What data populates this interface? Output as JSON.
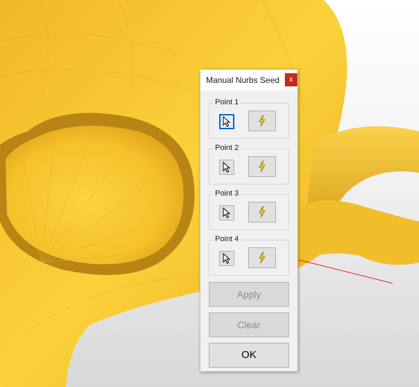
{
  "dialog": {
    "title": "Manual Nurbs Seed",
    "close_glyph": "x",
    "points": [
      {
        "label": "Point 1",
        "pick_icon": "cursor-icon",
        "seed_icon": "lightning-icon",
        "focused": true
      },
      {
        "label": "Point 2",
        "pick_icon": "cursor-icon",
        "seed_icon": "lightning-icon",
        "focused": false
      },
      {
        "label": "Point 3",
        "pick_icon": "cursor-icon",
        "seed_icon": "lightning-icon",
        "focused": false
      },
      {
        "label": "Point 4",
        "pick_icon": "cursor-icon",
        "seed_icon": "lightning-icon",
        "focused": false
      }
    ],
    "apply_label": "Apply",
    "apply_enabled": false,
    "clear_label": "Clear",
    "clear_enabled": false,
    "ok_label": "OK",
    "ok_enabled": true
  },
  "colors": {
    "mesh_yellow": "#f7c52a",
    "mesh_shadow": "#c9961a",
    "close_red": "#c42b1c",
    "focus_blue": "#0a64c8",
    "bolt_yellow": "#f2d41c",
    "seed_line": "#e02020"
  }
}
